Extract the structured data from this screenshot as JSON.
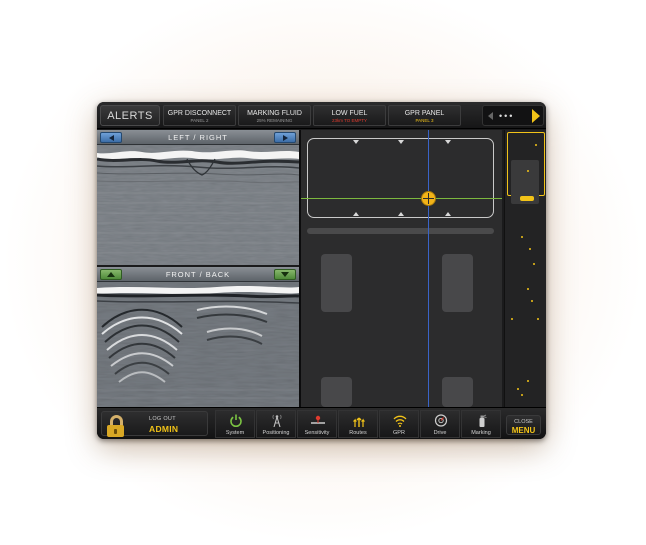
{
  "topbar": {
    "alerts_label": "ALERTS",
    "tabs": [
      {
        "title": "GPR DISCONNECT",
        "subtitle": "PANEL 2",
        "subtitle_color": "gray"
      },
      {
        "title": "MARKING FLUID",
        "subtitle": "25% REMAINING",
        "subtitle_color": "gray"
      },
      {
        "title": "LOW FUEL",
        "subtitle": "23km TO EMPTY",
        "subtitle_color": "red"
      },
      {
        "title": "GPR PANEL",
        "subtitle": "PANEL 3",
        "subtitle_color": "yellow"
      }
    ],
    "pager_dots": "•••"
  },
  "radar": {
    "top_label": "LEFT / RIGHT",
    "bottom_label": "FRONT / BACK"
  },
  "icons": {
    "left_arrow": "arrow-left-icon",
    "right_arrow": "arrow-right-icon",
    "up_arrow": "arrow-up-icon",
    "down_arrow": "arrow-down-icon",
    "lock": "lock-icon"
  },
  "bottombar": {
    "logout_small": "LOG OUT",
    "logout_big": "ADMIN",
    "nav": [
      {
        "label": "System",
        "icon": "power-icon"
      },
      {
        "label": "Positioning",
        "icon": "antenna-icon"
      },
      {
        "label": "Sensitivity",
        "icon": "slider-icon"
      },
      {
        "label": "Routes",
        "icon": "routes-icon"
      },
      {
        "label": "GPR",
        "icon": "signal-icon"
      },
      {
        "label": "Drive",
        "icon": "dial-icon"
      },
      {
        "label": "Marking",
        "icon": "spray-icon"
      }
    ],
    "close_small": "CLOSE",
    "close_big": "MENU"
  },
  "colors": {
    "accent": "#f2c318",
    "alert_red": "#e03b2e",
    "crosshair_vertical": "#3a64c8",
    "crosshair_horizontal": "#7cb83e"
  }
}
